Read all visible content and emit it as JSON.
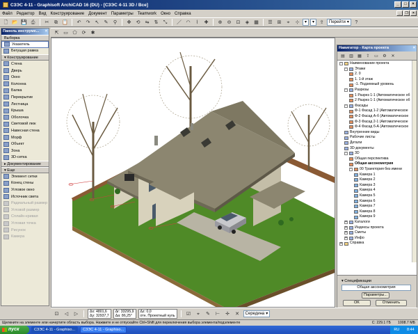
{
  "window": {
    "title": "СЗЭС 4-11 - Graphisoft ArchiCAD 16 (DU) - [СЗЭС 4-11 3D / Все]"
  },
  "menu": [
    "Файл",
    "Редактор",
    "Вид",
    "Конструирование",
    "Документ",
    "Параметры",
    "Teamwork",
    "Окно",
    "Справка"
  ],
  "toolbar": {
    "goto_label": "Перейти"
  },
  "toolbox": {
    "title": "Панель инструме...",
    "select_group": "Выборка",
    "select_tools": [
      {
        "label": "Указатель",
        "selected": true
      },
      {
        "label": "Бегущая рамка"
      }
    ],
    "construct_group": "Конструирование",
    "construct_tools": [
      "Стена",
      "Дверь",
      "Окно",
      "Колонна",
      "Балка",
      "Перекрытие",
      "Лестница",
      "Крыша",
      "Оболочка",
      "Световой люк",
      "Навесная стена",
      "Морф",
      "Объект",
      "Зона",
      "3D-сетка"
    ],
    "doc_group": "Документирование",
    "more_group": "Еще",
    "more_tools": [
      {
        "label": "Элемент сетки"
      },
      {
        "label": "Конец стены"
      },
      {
        "label": "Угловое окно"
      },
      {
        "label": "Источник света"
      },
      {
        "label": "Радиальный размер",
        "disabled": true
      },
      {
        "label": "Угловой размер",
        "disabled": true
      },
      {
        "label": "Сплайн-кривая",
        "disabled": true
      },
      {
        "label": "Угловая точка",
        "disabled": true
      },
      {
        "label": "Рисунок",
        "disabled": true
      },
      {
        "label": "Камера",
        "disabled": true
      }
    ]
  },
  "navigator": {
    "title": "Навигатор - Карта проекта",
    "tree": [
      {
        "label": "Наименование проекта",
        "level": 0,
        "exp": "-"
      },
      {
        "label": "Этажи",
        "level": 1,
        "exp": "-"
      },
      {
        "label": "2. 0",
        "level": 2
      },
      {
        "label": "1. 1-й этаж",
        "level": 2
      },
      {
        "label": "-1. Подземный уровень",
        "level": 2
      },
      {
        "label": "Разрезы",
        "level": 1,
        "exp": "-"
      },
      {
        "label": "1 Разрез 1-1 (Автоматическое об",
        "level": 2
      },
      {
        "label": "2 Разрез 1-1 (Автоматическое об",
        "level": 2
      },
      {
        "label": "Фасады",
        "level": 1,
        "exp": "-"
      },
      {
        "label": "Ф-1 Фасад 1-2 (Автоматическое",
        "level": 2
      },
      {
        "label": "Ф-2 Фасад А-б (Автоматическое",
        "level": 2
      },
      {
        "label": "Ф-3 Фасад 2-1 (Автоматическое",
        "level": 2
      },
      {
        "label": "Ф-4 Фасад б-А (Автоматическое",
        "level": 2
      },
      {
        "label": "Внутренние виды",
        "level": 1
      },
      {
        "label": "Рабочие листы",
        "level": 1
      },
      {
        "label": "Детали",
        "level": 1
      },
      {
        "label": "3D-документы",
        "level": 1
      },
      {
        "label": "3D",
        "level": 1,
        "exp": "-"
      },
      {
        "label": "Общая перспектива",
        "level": 2
      },
      {
        "label": "Общая аксонометрия",
        "level": 2,
        "bold": true
      },
      {
        "label": "00 Траектория без имени",
        "level": 2,
        "exp": "-"
      },
      {
        "label": "Камера 1",
        "level": 3
      },
      {
        "label": "Камера 2",
        "level": 3
      },
      {
        "label": "Камера 3",
        "level": 3
      },
      {
        "label": "Камера 4",
        "level": 3
      },
      {
        "label": "Камера 5",
        "level": 3
      },
      {
        "label": "Камера 6",
        "level": 3
      },
      {
        "label": "Камера 7",
        "level": 3
      },
      {
        "label": "Камера 8",
        "level": 3
      },
      {
        "label": "Камера 9",
        "level": 3
      },
      {
        "label": "Каталоги",
        "level": 1,
        "exp": "+"
      },
      {
        "label": "Индексы проекта",
        "level": 1,
        "exp": "+"
      },
      {
        "label": "Сметы",
        "level": 1,
        "exp": "+"
      },
      {
        "label": "Инфо",
        "level": 1,
        "exp": "+"
      },
      {
        "label": "Справка",
        "level": 0,
        "exp": "+"
      }
    ],
    "spec_label": "Спецификации",
    "spec_value": "Общая аксонометрия",
    "params_button": "Параметры...",
    "ok_button": "OK",
    "cancel_button": "Отменить"
  },
  "infobar": {
    "dx": "Δх: 4801,6",
    "dy": "Δу: 32937,7",
    "dr": "Δr: 33295,9",
    "da": "Δа: 86,25°",
    "dz": "Δz: 0,0",
    "rel": "отн. Проектный нуль",
    "mode": "Середина"
  },
  "status": {
    "hint": "Щелкните на элементе или начертите область выбора. Нажмите и не отпускайте Ctrl+Shift для переключения выбора элемента/подэлементе",
    "disk": "С: 229.1 ГБ",
    "mem": "1008.7 МБ"
  },
  "taskbar": {
    "start": "пуск",
    "tasks": [
      "СЗЭС 4-11 - Graphiso...",
      "СЗЭС 4-11 - Graphiso..."
    ],
    "lang": "RU",
    "time": "8:44"
  },
  "colors": {
    "titlebar": "#0a246a",
    "roof": "#8c8670",
    "grass": "#5f9a2e",
    "fence": "#8a5a34"
  }
}
